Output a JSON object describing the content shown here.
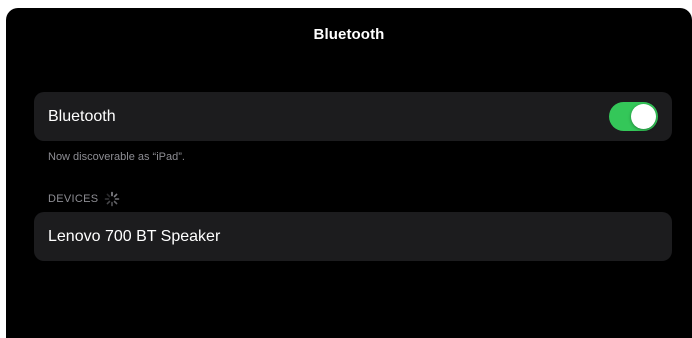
{
  "nav": {
    "title": "Bluetooth"
  },
  "bluetooth": {
    "label": "Bluetooth",
    "enabled": true,
    "toggle_color": "#34c759",
    "discoverable_note": "Now discoverable as “iPad”."
  },
  "devices": {
    "header": "DEVICES",
    "status_icon": "activity-spinner-icon",
    "items": [
      {
        "label": "Lenovo 700 BT Speaker"
      }
    ]
  }
}
